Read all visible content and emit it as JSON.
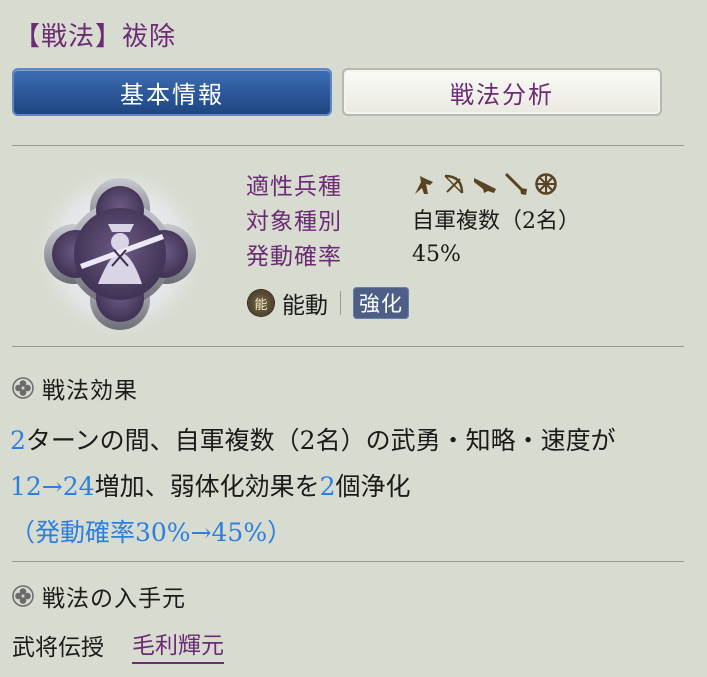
{
  "title": "【戦法】祓除",
  "tabs": [
    {
      "label": "基本情報",
      "active": true
    },
    {
      "label": "戦法分析",
      "active": false
    }
  ],
  "info": {
    "rows": [
      {
        "label": "適性兵種",
        "icons": [
          "cavalry-icon",
          "bow-icon",
          "gun-icon",
          "spear-icon",
          "wheel-icon"
        ]
      },
      {
        "label": "対象種別",
        "value": "自軍複数（2名）"
      },
      {
        "label": "発動確率",
        "value": "45%"
      }
    ],
    "trait_icon": "能",
    "trait_label": "能動",
    "badge": "強化"
  },
  "effect_section": {
    "heading": "戦法効果",
    "text": {
      "a": "2",
      "b": "ターンの間、自軍複数（2名）の武勇・知略・速度が",
      "c": "12→24",
      "d": "増加、弱体化効果を",
      "e": "2",
      "f": "個浄化",
      "g": "（発動確率30%→45%）"
    }
  },
  "source_section": {
    "heading": "戦法の入手元",
    "label": "武将伝授",
    "link": "毛利輝元"
  },
  "colors": {
    "background": "#d8dbcf",
    "title": "#6b2b75",
    "tab_active": "#2c5799",
    "highlight": "#2b7fe0",
    "badge": "#4d5f86"
  }
}
